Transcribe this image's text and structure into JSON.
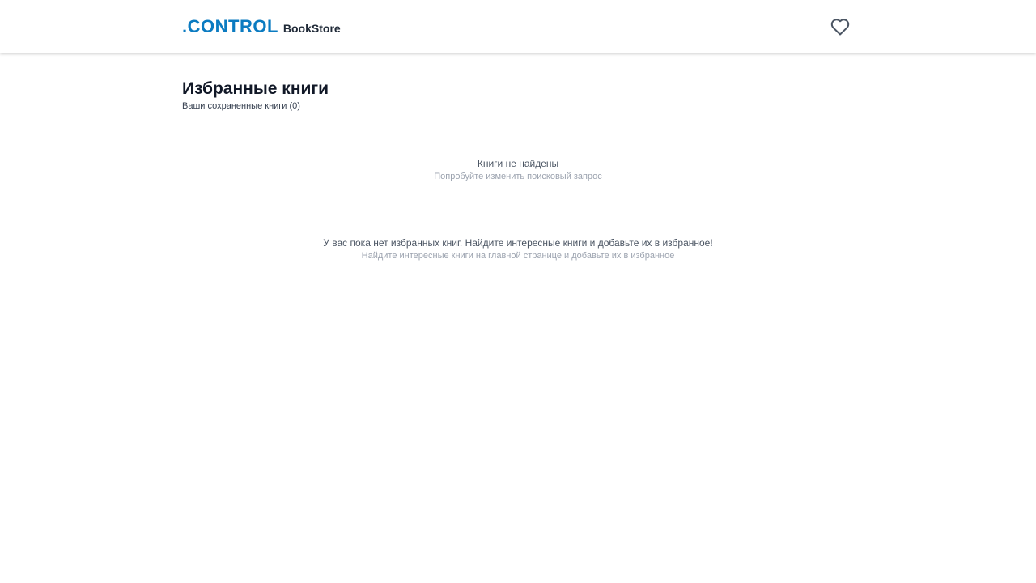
{
  "header": {
    "logo_brand": ".CONTROL",
    "logo_sub": "BookStore",
    "favorites_icon": "heart-icon"
  },
  "main": {
    "title": "Избранные книги",
    "subtitle": "Ваши сохраненные книги (0)"
  },
  "search_empty": {
    "title": "Книги не найдены",
    "hint": "Попробуйте изменить поисковый запрос"
  },
  "favorites_empty": {
    "title": "У вас пока нет избранных книг. Найдите интересные книги и добавьте их в избранное!",
    "hint": "Найдите интересные книги на главной странице и добавьте их в избранное"
  },
  "colors": {
    "brand": "#0b7bc1",
    "text_dark": "#111827",
    "text_muted": "#4b5563",
    "text_light": "#9ca3af"
  }
}
